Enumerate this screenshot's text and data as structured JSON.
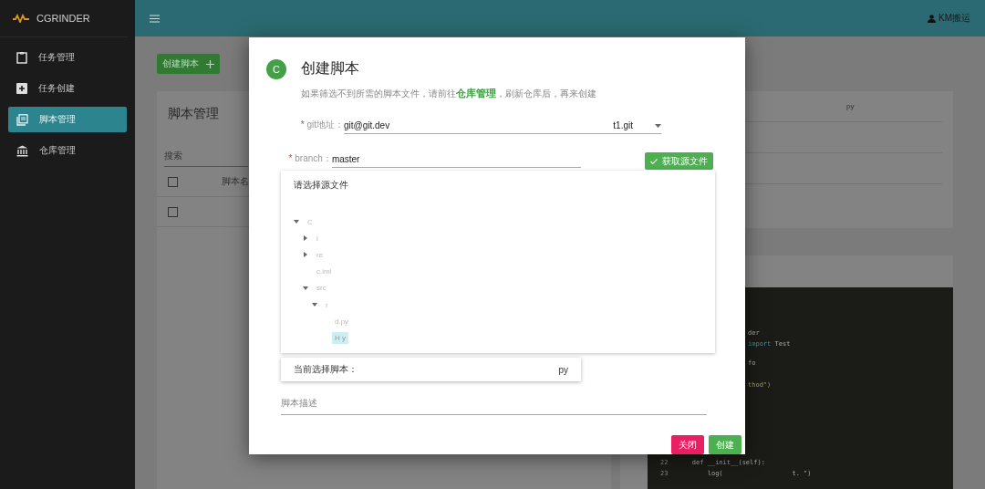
{
  "sidebar": {
    "logo": "CGRINDER",
    "items": [
      {
        "label": "任务管理",
        "selected": false
      },
      {
        "label": "任务创建",
        "selected": false
      },
      {
        "label": "脚本管理",
        "selected": true
      },
      {
        "label": "仓库管理",
        "selected": false
      }
    ]
  },
  "topbar": {
    "user": "KM搬运"
  },
  "background": {
    "create_button": "创建脚本",
    "card_title": "脚本管理",
    "search": {
      "placeholder": "搜索"
    },
    "rows": [
      {
        "checked": false,
        "text": "脚本名"
      },
      {
        "checked": false
      }
    ],
    "right_card": {
      "rows": [
        {
          "text": "py"
        },
        {},
        {}
      ]
    },
    "code_lines": [
      {
        "segments": [
          {
            "text": "der",
            "kind": "plain"
          }
        ]
      },
      {
        "segments": [
          {
            "text": "import",
            "kind": "keyword"
          },
          {
            "text": " Test",
            "kind": "plain"
          }
        ]
      },
      {
        "segments": [
          {
            "text": "fo",
            "kind": "plain"
          }
        ]
      },
      {
        "segments": [
          {
            "text": "thod\")",
            "kind": "string"
          }
        ]
      },
      {
        "number": "22",
        "segments": [
          {
            "text": "    def __init__(self):",
            "kind": "plain"
          }
        ]
      },
      {
        "number": "23",
        "segments": [
          {
            "text": "        log(",
            "kind": "plain"
          },
          {
            "text": "                  t. \")",
            "kind": "plain"
          }
        ]
      }
    ]
  },
  "dialog": {
    "avatar": "C",
    "title": "创建脚本",
    "hint": {
      "before": "如果筛选不到所需的脚本文件，请前往",
      "link": "仓库管理",
      "after": "，刷新仓库后，再来创建"
    },
    "git_field": {
      "required_mark": "*",
      "label": "git地址：",
      "value_start": "git@git.dev",
      "value_end": "t1.git"
    },
    "branch_field": {
      "required_mark": "*",
      "label": "branch：",
      "value": "master"
    },
    "fetch_button": "获取源文件",
    "tree": {
      "title": "请选择源文件",
      "nodes": [
        {
          "name": "C",
          "expanded": true,
          "selected": false,
          "children": [
            {
              "name": "l",
              "expanded": false,
              "selected": false
            },
            {
              "name": "re",
              "expanded": false,
              "selected": false
            },
            {
              "name": "c.iml",
              "selected": false
            },
            {
              "name": "src",
              "expanded": true,
              "selected": false,
              "children": [
                {
                  "name": "r",
                  "expanded": true,
                  "selected": false,
                  "children": [
                    {
                      "name": "d.py",
                      "selected": false
                    },
                    {
                      "name": "H          y",
                      "selected": true
                    }
                  ]
                }
              ]
            }
          ]
        }
      ]
    },
    "current_script": {
      "label": "当前选择脚本：",
      "value": "py"
    },
    "description": {
      "placeholder": "脚本描述"
    },
    "buttons": [
      {
        "label": "关闭",
        "kind": "cancel"
      },
      {
        "label": "创建",
        "kind": "confirm"
      }
    ]
  }
}
